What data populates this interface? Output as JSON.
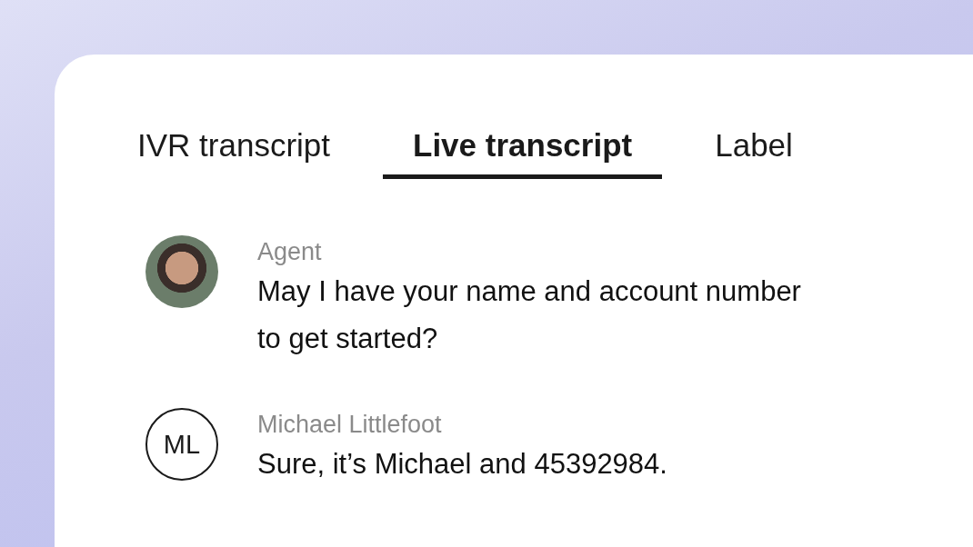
{
  "tabs": [
    {
      "label": "IVR transcript",
      "selected": false
    },
    {
      "label": "Live transcript",
      "selected": true
    },
    {
      "label": "Label",
      "selected": false
    }
  ],
  "messages": [
    {
      "kind": "photo",
      "speaker": "Agent",
      "text": "May I have your name and account number to get started?"
    },
    {
      "kind": "initials",
      "initials": "ML",
      "speaker": "Michael Littlefoot",
      "text": "Sure, it’s Michael and 45392984."
    }
  ]
}
